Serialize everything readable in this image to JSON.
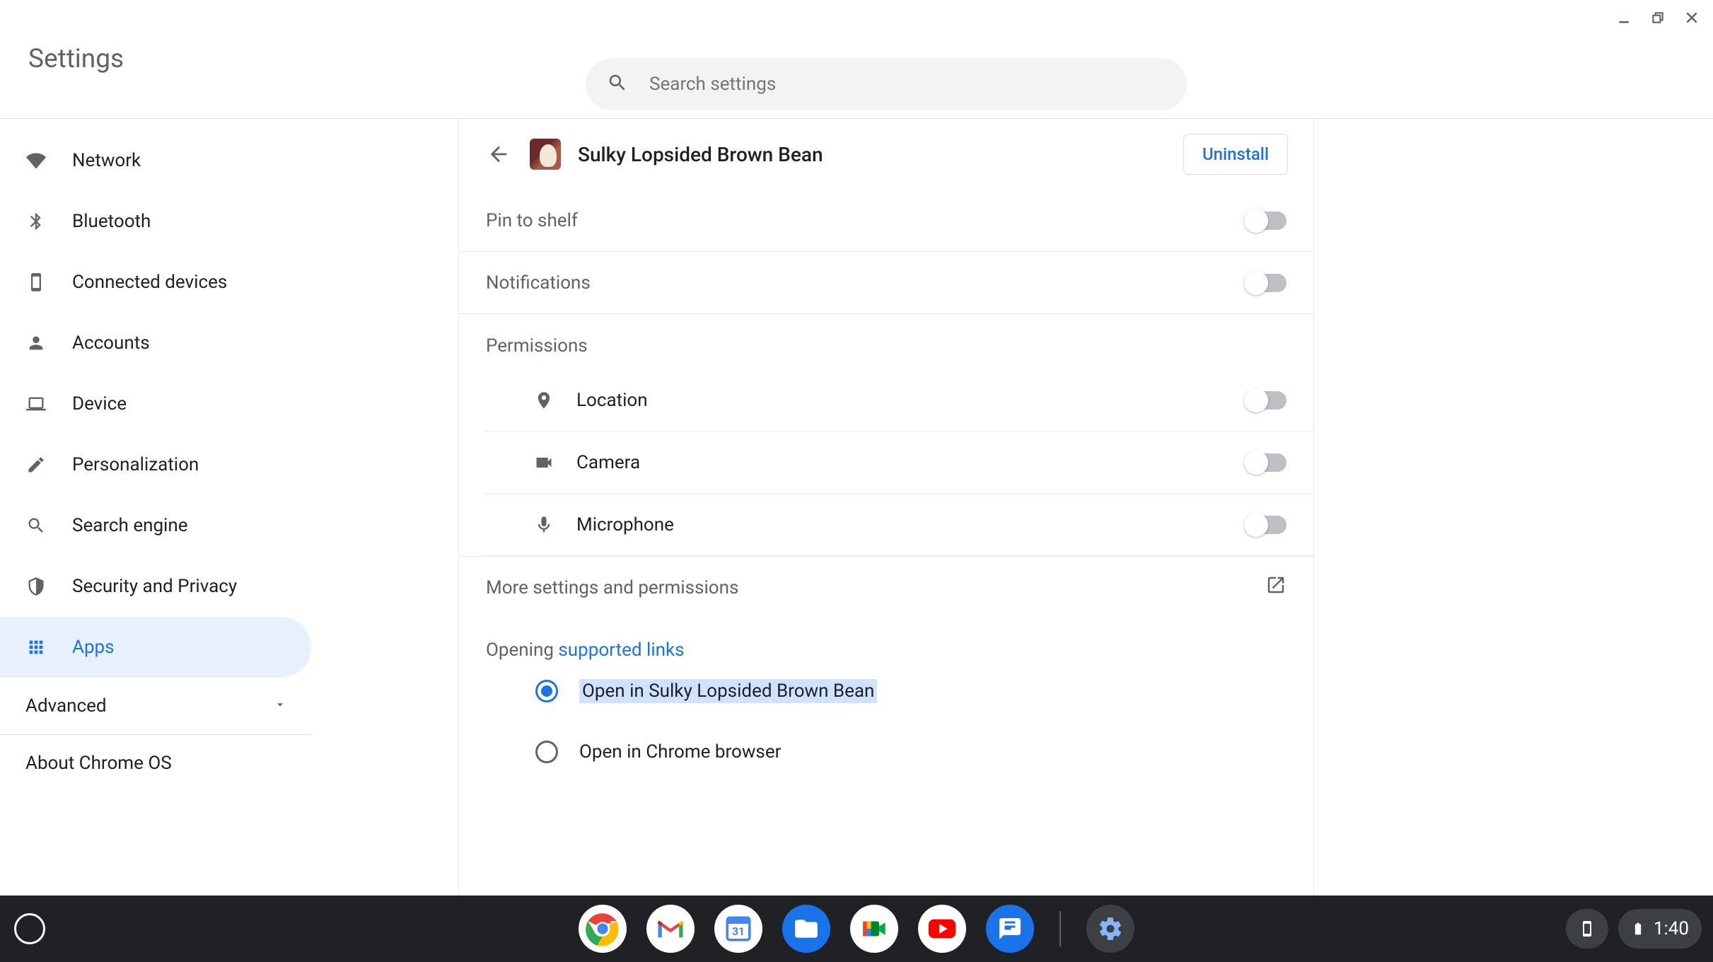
{
  "header": {
    "title": "Settings",
    "search_placeholder": "Search settings"
  },
  "sidebar": {
    "items": [
      {
        "label": "Network"
      },
      {
        "label": "Bluetooth"
      },
      {
        "label": "Connected devices"
      },
      {
        "label": "Accounts"
      },
      {
        "label": "Device"
      },
      {
        "label": "Personalization"
      },
      {
        "label": "Search engine"
      },
      {
        "label": "Security and Privacy"
      },
      {
        "label": "Apps"
      }
    ],
    "advanced": "Advanced",
    "about": "About Chrome OS"
  },
  "detail": {
    "app_name": "Sulky Lopsided Brown Bean",
    "uninstall": "Uninstall",
    "pin_to_shelf": "Pin to shelf",
    "notifications": "Notifications",
    "permissions_label": "Permissions",
    "permissions": {
      "location": "Location",
      "camera": "Camera",
      "microphone": "Microphone"
    },
    "more_settings": "More settings and permissions",
    "opening_prefix": "Opening ",
    "opening_link": "supported links",
    "radio_open_in_app": "Open in Sulky Lopsided Brown Bean",
    "radio_open_in_chrome": "Open in Chrome browser"
  },
  "shelf": {
    "time": "1:40"
  }
}
